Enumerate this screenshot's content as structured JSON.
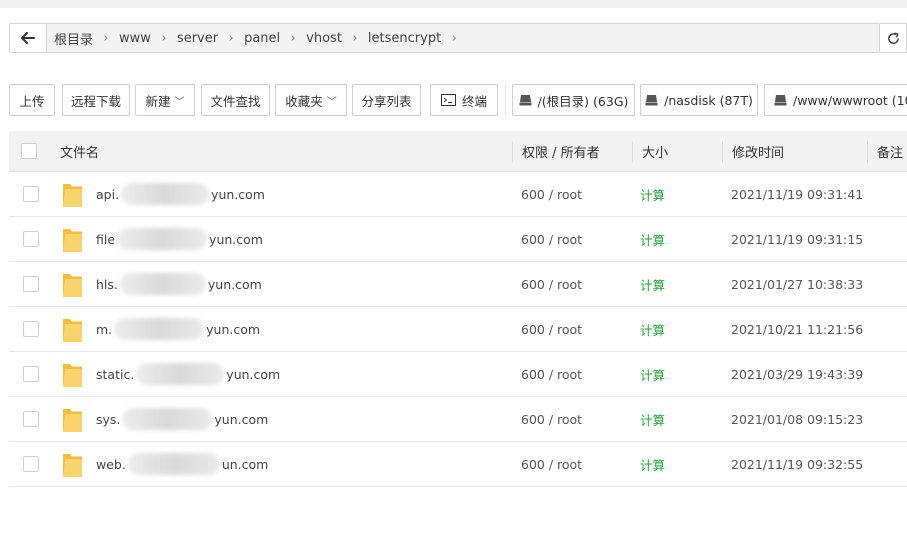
{
  "path": {
    "crumbs": [
      "根目录",
      "www",
      "server",
      "panel",
      "vhost",
      "letsencrypt"
    ]
  },
  "toolbar": {
    "upload": "上传",
    "remote_download": "远程下载",
    "new": "新建",
    "file_search": "文件查找",
    "favorites": "收藏夹",
    "share_list": "分享列表",
    "terminal": "终端",
    "disks": [
      "/(根目录) (63G)",
      "/nasdisk (87T)",
      "/www/wwwroot (10"
    ]
  },
  "table": {
    "headers": {
      "name": "文件名",
      "perm": "权限 / 所有者",
      "size": "大小",
      "mtime": "修改时间",
      "note": "备注"
    },
    "rows": [
      {
        "name_prefix": "api.",
        "name_suffix": "yun.com",
        "perm": "600 / root",
        "size": "计算",
        "mtime": "2021/11/19 09:31:41"
      },
      {
        "name_prefix": "file",
        "name_suffix": "yun.com",
        "perm": "600 / root",
        "size": "计算",
        "mtime": "2021/11/19 09:31:15"
      },
      {
        "name_prefix": "hls.",
        "name_suffix": "yun.com",
        "perm": "600 / root",
        "size": "计算",
        "mtime": "2021/01/27 10:38:33"
      },
      {
        "name_prefix": "m.",
        "name_suffix": "yun.com",
        "perm": "600 / root",
        "size": "计算",
        "mtime": "2021/10/21 11:21:56"
      },
      {
        "name_prefix": "static.",
        "name_suffix": "yun.com",
        "perm": "600 / root",
        "size": "计算",
        "mtime": "2021/03/29 19:43:39"
      },
      {
        "name_prefix": "sys.",
        "name_suffix": "yun.com",
        "perm": "600 / root",
        "size": "计算",
        "mtime": "2021/01/08 09:15:23"
      },
      {
        "name_prefix": "web.",
        "name_suffix": "un.com",
        "perm": "600 / root",
        "size": "计算",
        "mtime": "2021/11/19 09:32:55"
      }
    ]
  },
  "colors": {
    "accent_green": "#20a53a",
    "folder_yellow": "#f5c94f"
  },
  "icons": {
    "back": "arrow-left-icon",
    "refresh": "refresh-icon",
    "terminal": "terminal-icon",
    "disk": "disk-icon",
    "folder": "folder-icon"
  }
}
